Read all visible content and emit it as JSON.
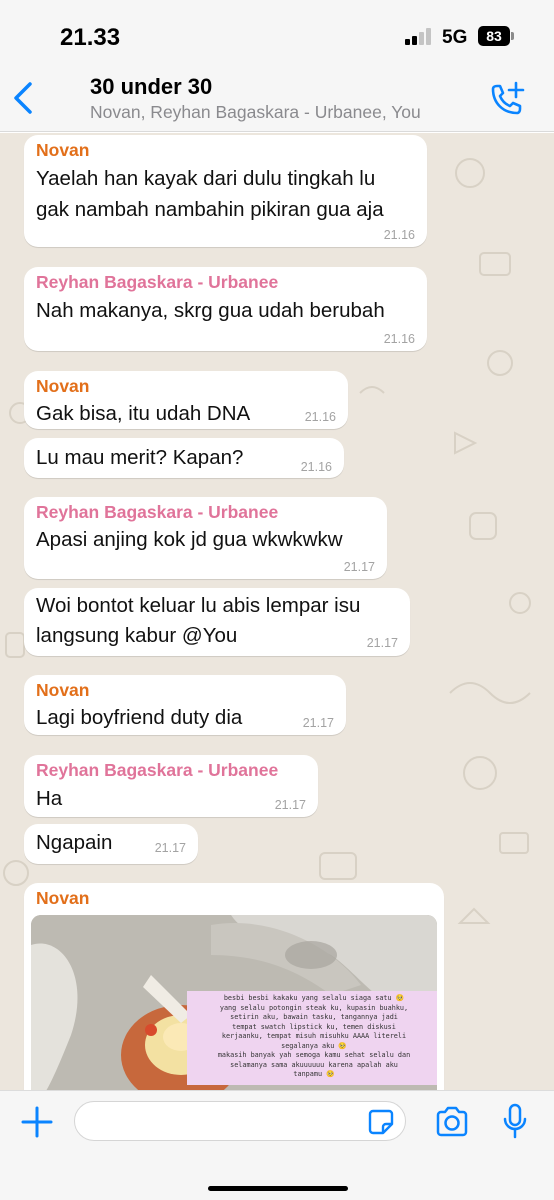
{
  "status_bar": {
    "time": "21.33",
    "network": "5G",
    "battery": "83"
  },
  "header": {
    "title": "30 under 30",
    "subtitle": "Novan, Reyhan Bagaskara - Urbanee, You",
    "back_icon": "chevron-left-icon",
    "call_icon": "add-call-icon"
  },
  "colors": {
    "accent": "#0a84ff",
    "novan": "#e26f1a",
    "reyhan": "#e0749a",
    "chat_bg": "#ece6dd"
  },
  "messages": [
    {
      "sender": "Novan",
      "lines": [
        "Yaelah han kayak dari dulu tingkah lu",
        "gak nambah nambahin pikiran gua aja"
      ],
      "time": "21.16"
    },
    {
      "sender": "Reyhan Bagaskara - Urbanee",
      "lines": [
        "Nah makanya, skrg gua udah berubah"
      ],
      "time": "21.16"
    },
    {
      "sender": "Novan",
      "lines": [
        "Gak bisa, itu udah DNA"
      ],
      "time": "21.16"
    },
    {
      "sender": "",
      "lines": [
        "Lu mau merit? Kapan?"
      ],
      "time": "21.16"
    },
    {
      "sender": "Reyhan Bagaskara - Urbanee",
      "lines": [
        "Apasi anjing kok jd gua wkwkwkw"
      ],
      "time": "21.17"
    },
    {
      "sender": "",
      "lines": [
        "Woi bontot keluar lu abis lempar isu",
        "langsung kabur @You"
      ],
      "time": "21.17"
    },
    {
      "sender": "Novan",
      "lines": [
        "Lagi boyfriend duty dia"
      ],
      "time": "21.17"
    },
    {
      "sender": "Reyhan Bagaskara - Urbanee",
      "lines": [
        "Ha"
      ],
      "time": "21.17"
    },
    {
      "sender": "",
      "lines": [
        "Ngapain"
      ],
      "time": "21.17"
    },
    {
      "sender": "Novan",
      "image_caption_lines": [
        "besbi besbi kakaku yang selalu siaga satu 🥺",
        "yang selalu potongin steak ku, kupasin buahku,",
        "setirin aku, bawain tasku, tangannya jadi",
        "tempat swatch lipstick ku, temen diskusi",
        "kerjaanku, tempat misuh misuhku AAAA litereli",
        "segalanya aku 🥺",
        "makasih banyak yah semoga kamu sehat selalu dan",
        "selamanya sama akuuuuuu karena apalah aku",
        "tanpamu 🥺"
      ]
    }
  ],
  "input": {
    "placeholder": ""
  }
}
